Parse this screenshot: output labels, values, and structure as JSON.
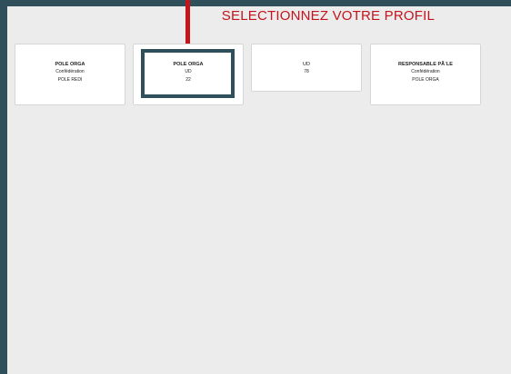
{
  "header": {
    "title": "SELECTIONNEZ VOTRE PROFIL"
  },
  "profiles": [
    {
      "role": "POLE ORGA",
      "level": "Confédération",
      "scope": "POLE REDI"
    },
    {
      "role": "POLE ORGA",
      "level": "UD",
      "scope": "22"
    },
    {
      "role": "UD",
      "level": "78",
      "scope": ""
    },
    {
      "role": "RESPONSABLE PÃ´LE",
      "level": "Confédération",
      "scope": "POLE ORGA"
    }
  ],
  "colors": {
    "accent": "#c4141c",
    "frame": "#2f4f5a",
    "background": "#ececec"
  }
}
